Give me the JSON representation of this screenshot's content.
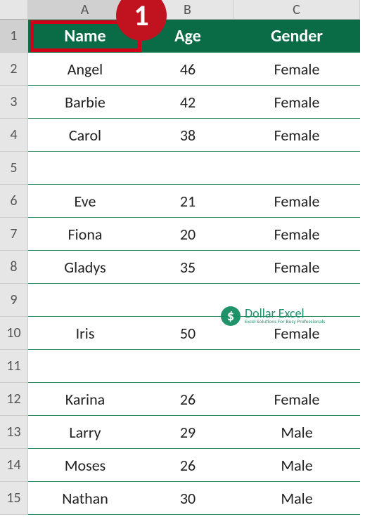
{
  "columns": [
    "A",
    "B",
    "C"
  ],
  "headers": {
    "name": "Name",
    "age": "Age",
    "gender": "Gender"
  },
  "rows": [
    {
      "num": "1"
    },
    {
      "num": "2",
      "name": "Angel",
      "age": "46",
      "gender": "Female"
    },
    {
      "num": "3",
      "name": "Barbie",
      "age": "42",
      "gender": "Female"
    },
    {
      "num": "4",
      "name": "Carol",
      "age": "38",
      "gender": "Female"
    },
    {
      "num": "5",
      "name": "",
      "age": "",
      "gender": ""
    },
    {
      "num": "6",
      "name": "Eve",
      "age": "21",
      "gender": "Female"
    },
    {
      "num": "7",
      "name": "Fiona",
      "age": "20",
      "gender": "Female"
    },
    {
      "num": "8",
      "name": "Gladys",
      "age": "35",
      "gender": "Female"
    },
    {
      "num": "9",
      "name": "",
      "age": "",
      "gender": ""
    },
    {
      "num": "10",
      "name": "Iris",
      "age": "50",
      "gender": "Female"
    },
    {
      "num": "11",
      "name": "",
      "age": "",
      "gender": ""
    },
    {
      "num": "12",
      "name": "Karina",
      "age": "26",
      "gender": "Female"
    },
    {
      "num": "13",
      "name": "Larry",
      "age": "29",
      "gender": "Male"
    },
    {
      "num": "14",
      "name": "Moses",
      "age": "26",
      "gender": "Male"
    },
    {
      "num": "15",
      "name": "Nathan",
      "age": "30",
      "gender": "Male"
    }
  ],
  "annotation": {
    "badge": "1"
  },
  "watermark": {
    "symbol": "$",
    "title": "Dollar Excel",
    "subtitle": "Excel Solutions For Busy Professionals"
  },
  "selected_cell": "A1",
  "colors": {
    "header_bg": "#0a6b47",
    "grid_green": "#2b8a5c",
    "badge_red": "#c1121f",
    "highlight_red": "#d00018"
  }
}
